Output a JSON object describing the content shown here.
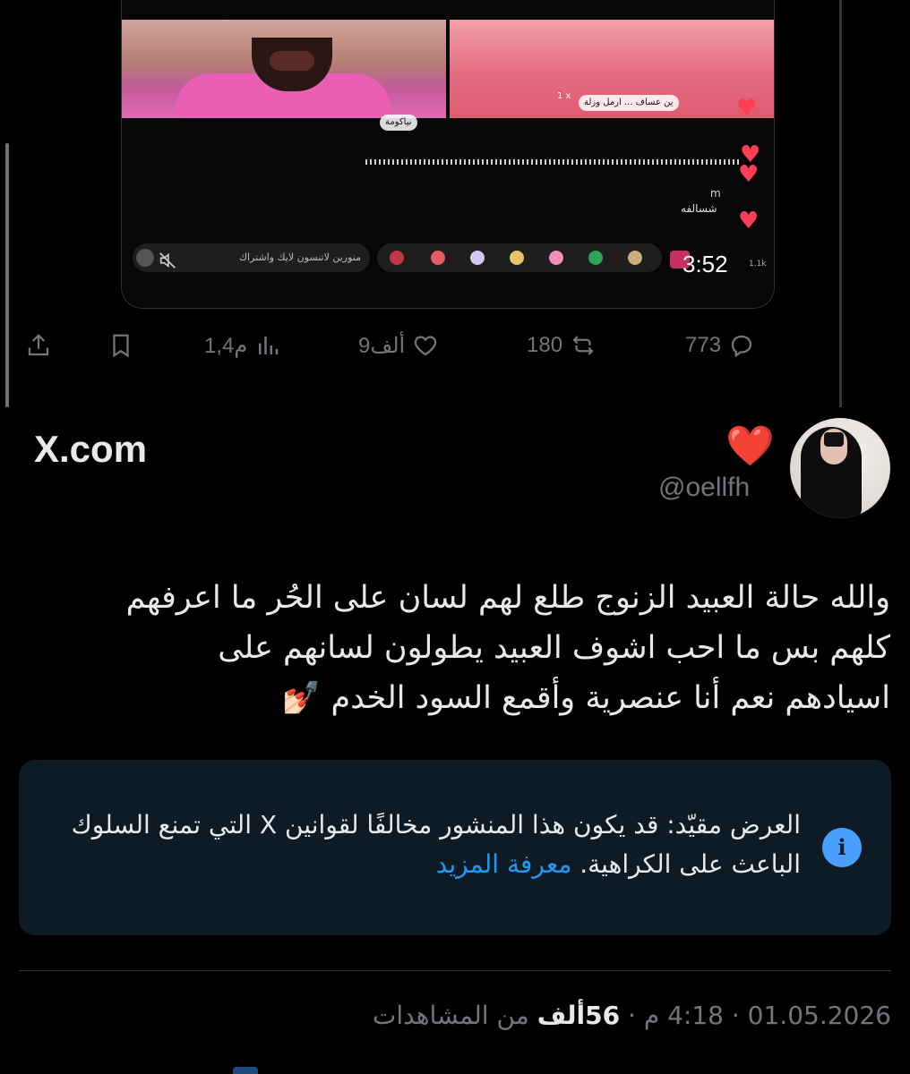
{
  "video": {
    "name_left": "نياكومة",
    "name_right": "ين عساف ... ارمل وزلة",
    "gift_count": "1 x",
    "chat_user": "m",
    "chat_message": "شسالفه",
    "comment_placeholder": "منورين لاتنسون لايك واشتراك",
    "viewers": "1.1k",
    "duration": "3:52"
  },
  "actions": {
    "replies": "773",
    "reposts": "180",
    "likes": "9ألف",
    "views": "1,4م"
  },
  "brand": {
    "label": "X.com"
  },
  "author": {
    "handle": "@oellfh",
    "emoji": "❤️"
  },
  "tweet": {
    "line1": "والله حالة العبيد الزنوج طلع لهم لسان على الحُر ما اعرفهم",
    "line2": "كلهم بس ما احب اشوف العبيد يطولون لسانهم على",
    "line3": "اسيادهم نعم أنا عنصرية وأقمع السود الخدم 💅🏻"
  },
  "notice": {
    "text": "العرض مقيّد: قد يكون هذا المنشور مخالفًا لقوانين X التي تمنع السلوك الباعث على الكراهية.",
    "link": "معرفة المزيد"
  },
  "meta": {
    "date": "01.05.2026",
    "time": "4:18 م",
    "views_count": "56ألف",
    "views_label": "من المشاهدات"
  },
  "colors": {
    "accent": "#1d9bf0",
    "notice_bg": "#0e1a24",
    "muted": "#71767b"
  }
}
